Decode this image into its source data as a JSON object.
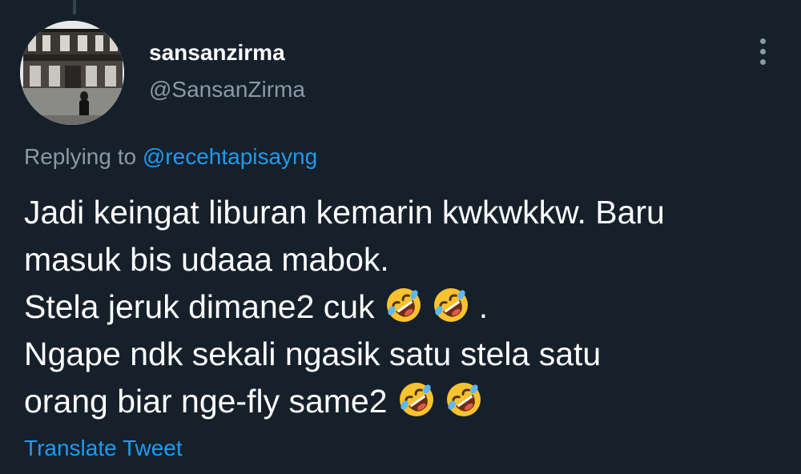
{
  "user": {
    "display_name": "sansanzirma",
    "handle": "@SansanZirma",
    "avatar_icon": "avatar-photo-icon"
  },
  "menu": {
    "more_icon": "more-vertical-icon"
  },
  "reply": {
    "prefix": "Replying to ",
    "mention": "@recehtapisayng"
  },
  "tweet": {
    "lines": [
      {
        "text": "Jadi keingat liburan kemarin kwkwkkw. Baru",
        "emoji_count": 0,
        "suffix": ""
      },
      {
        "text": "masuk bis udaaa mabok.",
        "emoji_count": 0,
        "suffix": ""
      },
      {
        "text": "Stela jeruk dimane2 cuk",
        "emoji_count": 2,
        "suffix": "."
      },
      {
        "text": "Ngape ndk sekali ngasik satu stela satu",
        "emoji_count": 0,
        "suffix": ""
      },
      {
        "text": "orang biar nge-fly same2",
        "emoji_count": 2,
        "suffix": ""
      }
    ],
    "emoji_icon": "rolling-on-floor-laughing-icon"
  },
  "actions": {
    "translate_label": "Translate Tweet"
  },
  "colors": {
    "background": "#15202b",
    "primary_text": "#ffffff",
    "secondary_text": "#8b98a5",
    "accent": "#1d9bf0"
  }
}
